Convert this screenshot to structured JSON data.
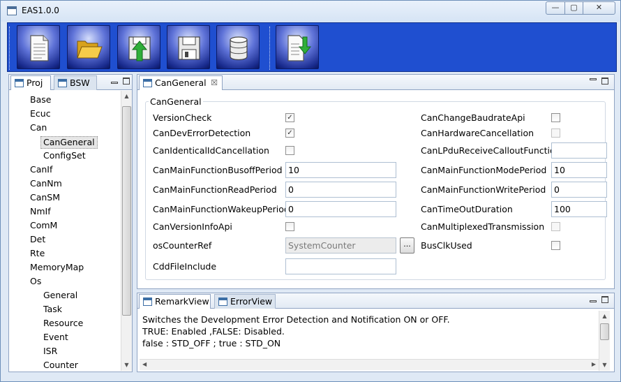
{
  "window": {
    "title": "EAS1.0.0",
    "controls": {
      "minimize": "—",
      "maximize": "▢",
      "close": "✕"
    }
  },
  "toolbar": {
    "buttons": [
      {
        "icon": "new-document-icon"
      },
      {
        "icon": "open-folder-icon"
      },
      {
        "icon": "import-upload-icon"
      },
      {
        "icon": "save-disk-icon"
      },
      {
        "icon": "database-icon"
      },
      {
        "icon": "generate-download-icon"
      }
    ]
  },
  "left_panel": {
    "tabs": [
      {
        "label": "Proj",
        "active": true
      },
      {
        "label": "BSW",
        "active": false
      }
    ],
    "tree": [
      {
        "label": "Base",
        "level": 0
      },
      {
        "label": "Ecuc",
        "level": 0
      },
      {
        "label": "Can",
        "level": 0
      },
      {
        "label": "CanGeneral",
        "level": 1,
        "selected": true
      },
      {
        "label": "ConfigSet",
        "level": 1
      },
      {
        "label": "CanIf",
        "level": 0
      },
      {
        "label": "CanNm",
        "level": 0
      },
      {
        "label": "CanSM",
        "level": 0
      },
      {
        "label": "NmIf",
        "level": 0
      },
      {
        "label": "ComM",
        "level": 0
      },
      {
        "label": "Det",
        "level": 0
      },
      {
        "label": "Rte",
        "level": 0
      },
      {
        "label": "MemoryMap",
        "level": 0
      },
      {
        "label": "Os",
        "level": 0
      },
      {
        "label": "General",
        "level": 1
      },
      {
        "label": "Task",
        "level": 1
      },
      {
        "label": "Resource",
        "level": 1
      },
      {
        "label": "Event",
        "level": 1
      },
      {
        "label": "ISR",
        "level": 1
      },
      {
        "label": "Counter",
        "level": 1
      }
    ]
  },
  "editor": {
    "tab_label": "CanGeneral",
    "tab_close": "☒",
    "group_title": "CanGeneral",
    "left_params": [
      {
        "label": "VersionCheck",
        "type": "checkbox",
        "checked": true,
        "mark": "✓"
      },
      {
        "label": "CanDevErrorDetection",
        "type": "checkbox",
        "checked": true,
        "mark": "✓"
      },
      {
        "label": "CanIdenticalIdCancellation",
        "type": "checkbox",
        "checked": false,
        "mark": ""
      },
      {
        "label": "CanMainFunctionBusoffPeriod",
        "type": "text",
        "value": "10"
      },
      {
        "label": "CanMainFunctionReadPeriod",
        "type": "text",
        "value": "0"
      },
      {
        "label": "CanMainFunctionWakeupPeriod",
        "type": "text",
        "value": "0"
      },
      {
        "label": "CanVersionInfoApi",
        "type": "checkbox",
        "checked": false,
        "mark": ""
      },
      {
        "label": "osCounterRef",
        "type": "reference",
        "value": "SystemCounter",
        "button": "..."
      },
      {
        "label": "CddFileInclude",
        "type": "text",
        "value": ""
      }
    ],
    "right_params": [
      {
        "label": "CanChangeBaudrateApi",
        "type": "checkbox",
        "checked": false,
        "mark": ""
      },
      {
        "label": "CanHardwareCancellation",
        "type": "checkbox",
        "checked": false,
        "disabled": true,
        "mark": ""
      },
      {
        "label": "CanLPduReceiveCalloutFunction",
        "type": "text",
        "value": ""
      },
      {
        "label": "CanMainFunctionModePeriod",
        "type": "text",
        "value": "10"
      },
      {
        "label": "CanMainFunctionWritePeriod",
        "type": "text",
        "value": "0"
      },
      {
        "label": "CanTimeOutDuration",
        "type": "text",
        "value": "100"
      },
      {
        "label": "CanMultiplexedTransmission",
        "type": "checkbox",
        "checked": false,
        "disabled": true,
        "mark": ""
      },
      {
        "label": "BusClkUsed",
        "type": "checkbox",
        "checked": false,
        "mark": ""
      }
    ]
  },
  "bottom_panel": {
    "tabs": [
      {
        "label": "RemarkView",
        "active": true
      },
      {
        "label": "ErrorView",
        "active": false
      }
    ],
    "remark_lines": [
      "Switches the Development Error Detection and Notification ON or OFF.",
      "TRUE: Enabled ,FALSE: Disabled.",
      "false : STD_OFF ; true : STD_ON"
    ]
  },
  "colors": {
    "toolbar_bg": "#1f4fd0",
    "window_bg": "#dfe9f5",
    "panel_border": "#90a4c3"
  }
}
